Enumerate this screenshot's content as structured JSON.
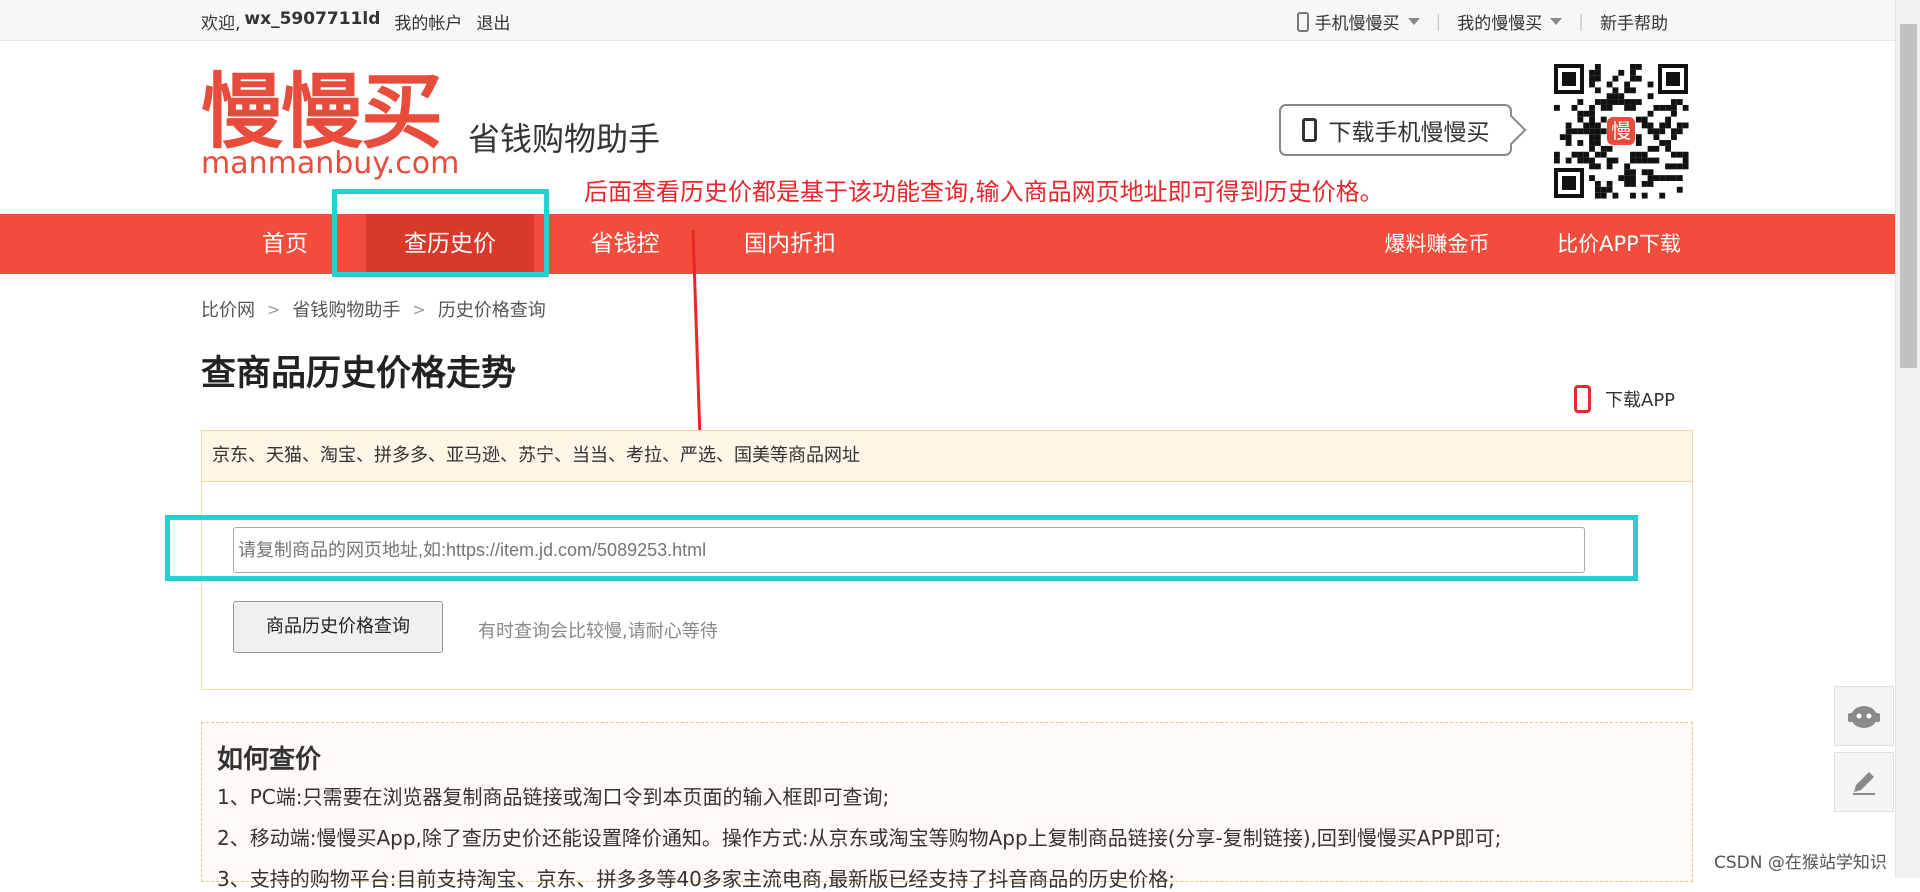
{
  "topbar": {
    "welcome": "欢迎,",
    "username": "wx_5907711ld",
    "my_account": "我的帐户",
    "logout": "退出",
    "mobile_app": "手机慢慢买",
    "my_mmb": "我的慢慢买",
    "help": "新手帮助"
  },
  "header": {
    "logo_cn": "慢慢买",
    "logo_en": "manmanbuy.com",
    "slogan": "省钱购物助手",
    "download_phone": "下载手机慢慢买",
    "qr_center": "慢",
    "annotation": "后面查看历史价都是基于该功能查询,输入商品网页地址即可得到历史价格。"
  },
  "nav": {
    "items": [
      "首页",
      "查历史价",
      "省钱控",
      "国内折扣"
    ],
    "right_items": [
      "爆料赚金币",
      "比价APP下载"
    ]
  },
  "breadcrumb": [
    "比价网",
    "省钱购物助手",
    "历史价格查询"
  ],
  "page_title": "查商品历史价格走势",
  "download_app": "下载APP",
  "search": {
    "platforms": "京东、天猫、淘宝、拼多多、亚马逊、苏宁、当当、考拉、严选、国美等商品网址",
    "placeholder": "请复制商品的网页地址,如:https://item.jd.com/5089253.html",
    "button": "商品历史价格查询",
    "hint": "有时查询会比较慢,请耐心等待"
  },
  "howto": {
    "title": "如何查价",
    "lines": [
      "1、PC端:只需要在浏览器复制商品链接或淘口令到本页面的输入框即可查询;",
      "2、移动端:慢慢买App,除了查历史价还能设置降价通知。操作方式:从京东或淘宝等购物App上复制商品链接(分享-复制链接),回到慢慢买APP即可;",
      "3、支持的购物平台:目前支持淘宝、京东、拼多多等40多家主流电商,最新版已经支持了抖音商品的历史价格;"
    ]
  },
  "watermark": "CSDN @在猴站学知识",
  "colors": {
    "brand_red": "#e74c3c",
    "nav_red": "#f24d3c",
    "nav_active": "#d8392b",
    "annotation_cyan": "#26cfd2",
    "annotation_red": "#e8262b"
  }
}
